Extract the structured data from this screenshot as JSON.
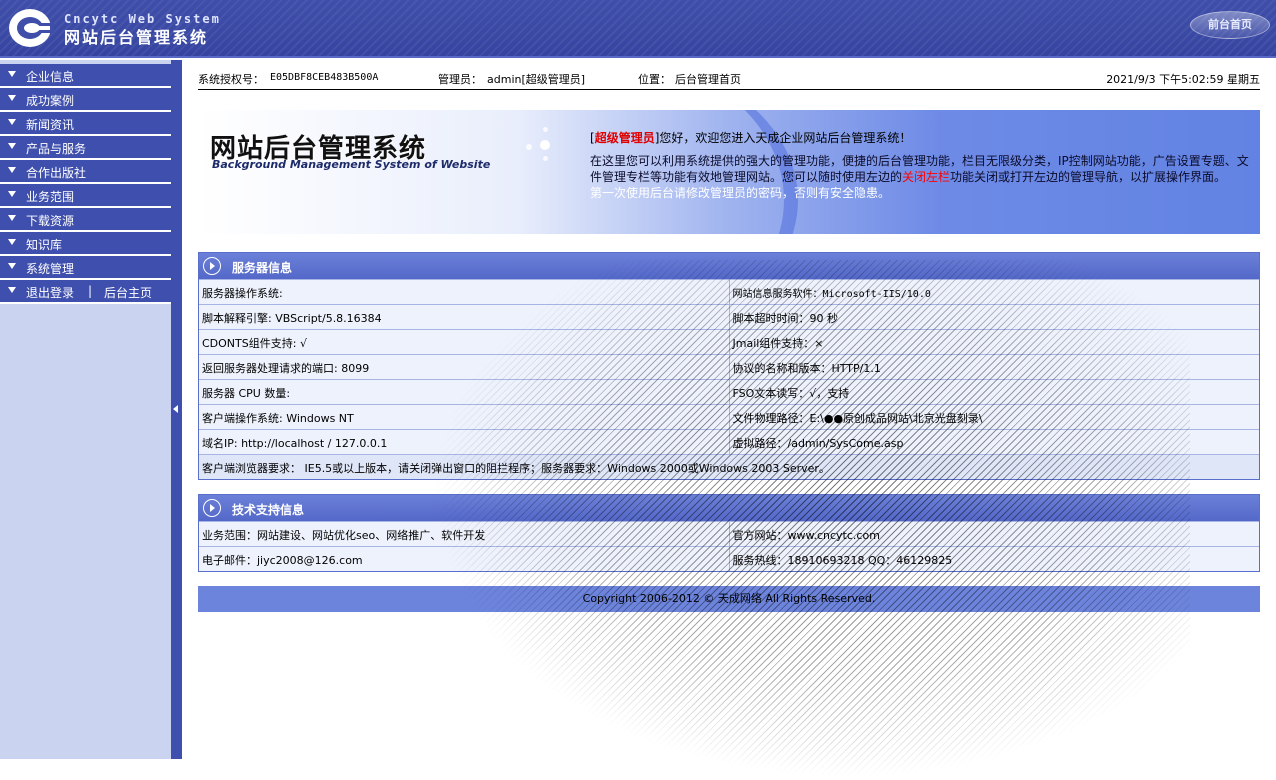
{
  "header": {
    "logo_icon": "c-logo-icon",
    "brand_en": "Cncytc Web System",
    "brand_cn": "网站后台管理系统",
    "front_link": "前台首页"
  },
  "sidebar": {
    "items": [
      {
        "label": "企业信息"
      },
      {
        "label": "成功案例"
      },
      {
        "label": "新闻资讯"
      },
      {
        "label": "产品与服务"
      },
      {
        "label": "合作出版社"
      },
      {
        "label": "业务范围"
      },
      {
        "label": "下载资源"
      },
      {
        "label": "知识库"
      },
      {
        "label": "系统管理"
      }
    ],
    "logout": "退出登录",
    "separator": "|",
    "home": "后台主页"
  },
  "infobar": {
    "license_label": "系统授权号：",
    "license_value": "E05DBF8CEB483B500A",
    "admin_label": "管理员：",
    "admin_value": "admin[超级管理员]",
    "location_label": "位置：",
    "location_value": "后台管理首页",
    "datetime": "2021/9/3 下午5:02:59 星期五"
  },
  "banner": {
    "title": "网站后台管理系统",
    "subtitle": "Background Management System of Website",
    "welcome_prefix": "[",
    "welcome_role": "超级管理员",
    "welcome_suffix": "]您好，欢迎您进入天成企业网站后台管理系统！",
    "line2_a": "在这里您可以利用系统提供的强大的管理功能，便捷的后台管理功能，栏目无限级分类，IP控制网站功能，广告设置专题、文件管理专栏等功能有效地管理网站。您可以随时使用左边的",
    "line2_red": "关闭左栏",
    "line2_b": "功能关闭或打开左边的管理导航，以扩展操作界面。",
    "line3": "第一次使用后台请修改管理员的密码，否则有安全隐患。"
  },
  "server_panel": {
    "title": "服务器信息",
    "rows": [
      [
        "服务器操作系统:",
        "网站信息服务软件：Microsoft-IIS/10.0"
      ],
      [
        "脚本解释引擎: VBScript/5.8.16384",
        "脚本超时时间：90 秒"
      ],
      [
        "CDONTS组件支持: √",
        "Jmail组件支持：×"
      ],
      [
        "返回服务器处理请求的端口: 8099",
        "协议的名称和版本：HTTP/1.1"
      ],
      [
        "服务器 CPU 数量:",
        "FSO文本读写：√，支持"
      ],
      [
        "客户端操作系统: Windows NT",
        "文件物理路径：E:\\●●原创成品网站\\北京光盘刻录\\"
      ],
      [
        "域名IP: http://localhost  / 127.0.0.1",
        "虚拟路径：/admin/SysCome.asp"
      ]
    ],
    "browser_req": "客户端浏览器要求： IE5.5或以上版本，请关闭弹出窗口的阻拦程序；服务器要求：Windows 2000或Windows 2003 Server。"
  },
  "tech_panel": {
    "title": "技术支持信息",
    "rows": [
      [
        "业务范围：网站建设、网站优化seo、网络推广、软件开发",
        "官方网站：www.cncytc.com"
      ],
      [
        "电子邮件：jiyc2008@126.com",
        "服务热线：18910693218    QQ：46129825"
      ]
    ]
  },
  "footer": {
    "text": "Copyright 2006-2012 © 天成网络 All Rights Reserved."
  },
  "colors": {
    "header_bg": "#3e4ea9",
    "sidebar_bg": "#cad4f0",
    "menu_bg": "#3f4fad",
    "panel_head": "#5f74d1",
    "cell_bg": "#eef2fc",
    "accent_red": "#ff0000"
  }
}
